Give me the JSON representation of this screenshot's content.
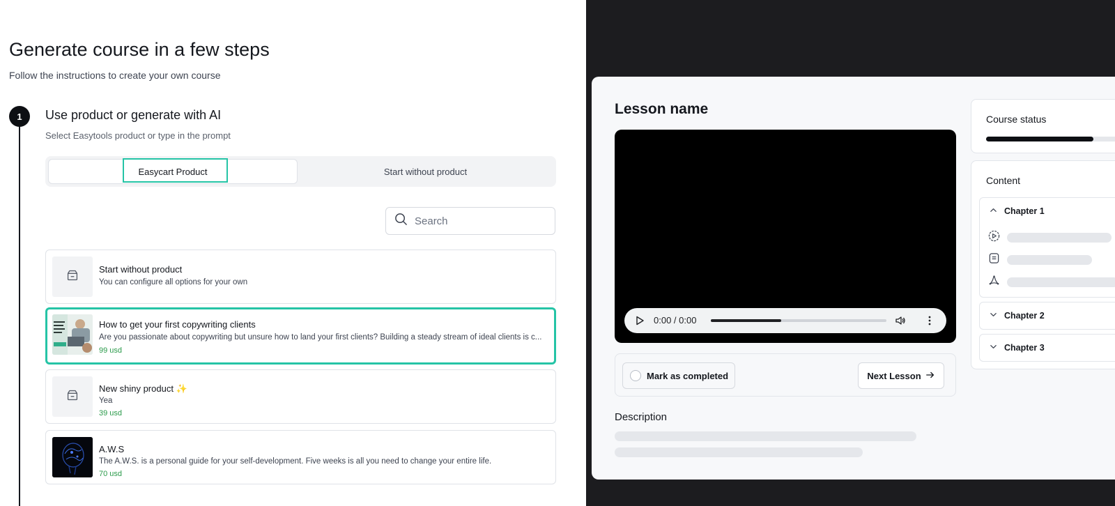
{
  "left": {
    "title": "Generate course in a few steps",
    "subtitle": "Follow the instructions to create your own course",
    "step": {
      "number": "1",
      "title": "Use product or generate with AI",
      "subtitle": "Select Easytools product or type in the prompt"
    },
    "tabs": [
      {
        "label": "Easycart Product",
        "active": true
      },
      {
        "label": "Start without product",
        "active": false
      }
    ],
    "search": {
      "placeholder": "Search",
      "value": ""
    },
    "products": [
      {
        "title": "Start without product",
        "description": "You can configure all options for your own",
        "price": "",
        "thumb": "box-icon",
        "selected": false
      },
      {
        "title": "How to get your first copywriting clients",
        "description": "Are you passionate about copywriting but unsure how to land your first clients? Building a steady stream of ideal clients is c...",
        "price": "99 usd",
        "thumb": "photo",
        "selected": true
      },
      {
        "title": "New shiny product ✨",
        "description": "Yea",
        "price": "39 usd",
        "thumb": "box-icon",
        "selected": false
      },
      {
        "title": "A.W.S",
        "description": "The A.W.S. is a personal guide for your self-development. Five weeks is all you need to change your entire life.",
        "price": "70 usd",
        "thumb": "dark-image",
        "selected": false
      }
    ],
    "accent_color": "#25c4a6",
    "price_color": "#2a9a4a"
  },
  "preview": {
    "lesson_title": "Lesson name",
    "video": {
      "time": "0:00 / 0:00",
      "progress": 0.4
    },
    "mark_completed": "Mark as completed",
    "next_lesson": "Next Lesson",
    "description_label": "Description",
    "course_status_label": "Course status",
    "course_progress": 0.77,
    "content_label": "Content",
    "chapters": [
      {
        "title": "Chapter 1",
        "expanded": true,
        "items": [
          "video-icon",
          "document-icon",
          "pdf-icon"
        ]
      },
      {
        "title": "Chapter 2",
        "expanded": false
      },
      {
        "title": "Chapter 3",
        "expanded": false
      }
    ]
  }
}
